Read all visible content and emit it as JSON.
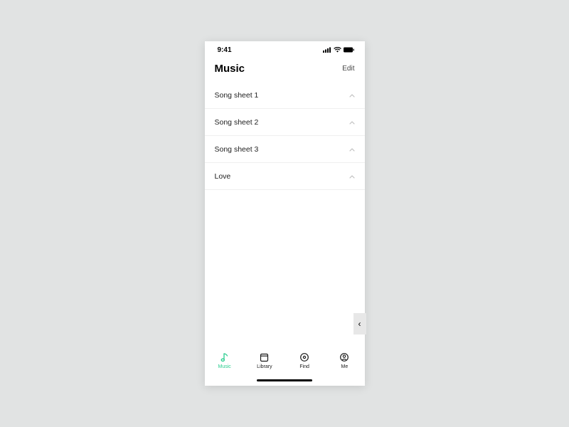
{
  "status": {
    "time": "9:41"
  },
  "header": {
    "title": "Music",
    "edit": "Edit"
  },
  "playlists": [
    {
      "name": "Song sheet 1"
    },
    {
      "name": "Song sheet 2"
    },
    {
      "name": "Song sheet 3"
    },
    {
      "name": "Love"
    }
  ],
  "tabs": {
    "music": "Music",
    "library": "Library",
    "find": "Find",
    "me": "Me"
  },
  "sideTab": "‹"
}
